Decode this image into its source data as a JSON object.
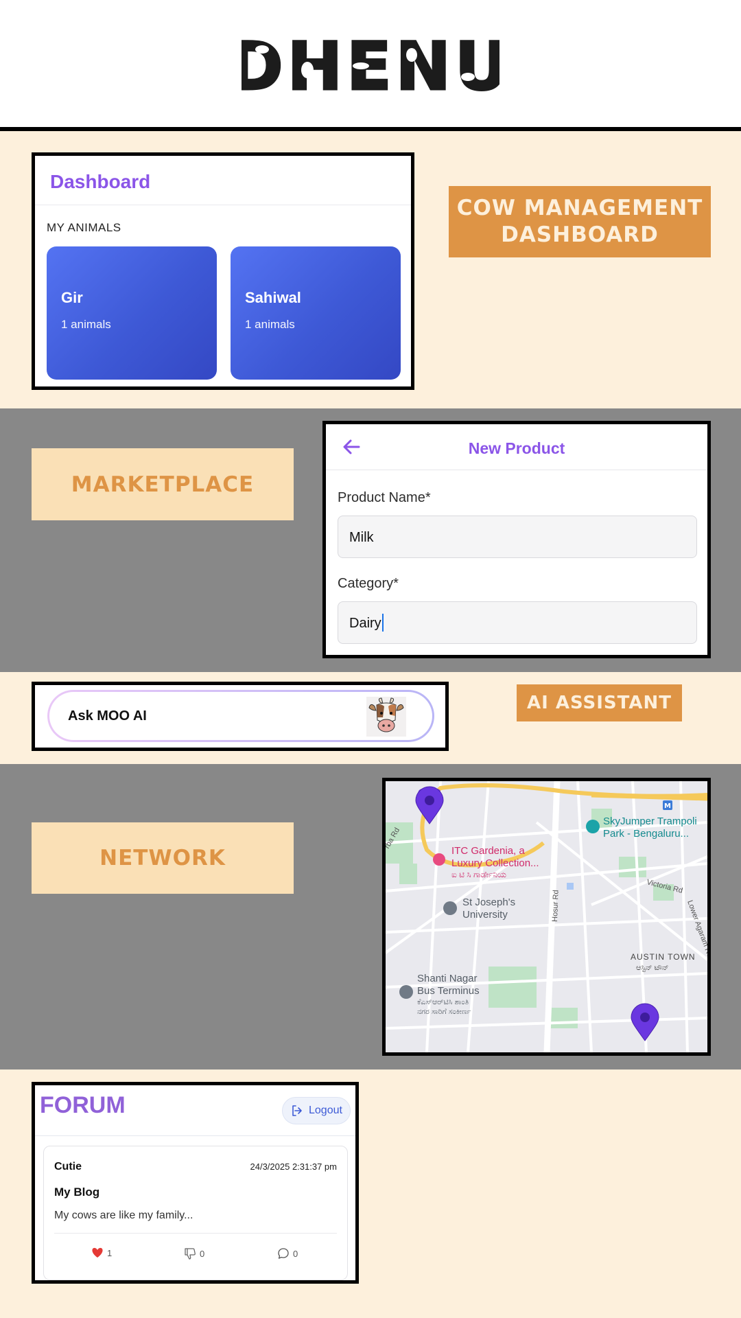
{
  "header": {
    "logo_text": "DHENU"
  },
  "labels": {
    "cow_management": "COW MANAGEMENT DASHBOARD",
    "marketplace": "MARKETPLACE",
    "ai_assistant": "AI ASSISTANT",
    "network": "NETWORK"
  },
  "dashboard": {
    "title": "Dashboard",
    "section": "MY ANIMALS",
    "animals": [
      {
        "name": "Gir",
        "count": "1 animals"
      },
      {
        "name": "Sahiwal",
        "count": "1 animals"
      }
    ]
  },
  "product": {
    "title": "New Product",
    "fields": [
      {
        "label": "Product Name*",
        "value": "Milk"
      },
      {
        "label": "Category*",
        "value": "Dairy"
      }
    ]
  },
  "ai": {
    "prompt": "Ask MOO AI"
  },
  "map": {
    "places": [
      {
        "name": "ITC Gardenia, a",
        "name2": "Luxury Collection...",
        "local": "ಐ ಟಿ ಸಿ ಗಾರ್ಡೇನಿಯ"
      },
      {
        "name": "St Joseph's",
        "name2": "University"
      },
      {
        "name": "SkyJumper Trampoli",
        "name2": "Park - Bengaluru..."
      },
      {
        "name": "Shanti Nagar",
        "name2": "Bus Terminus",
        "local": "ಕೆಎಸ್‌ಆರ್‌ಟಿಸಿ ಶಾಂತಿ",
        "local2": "ನಗರ ಸಾರಿಗೆ ಸಂಕೀರ್ಣ"
      },
      {
        "name": "AUSTIN TOWN",
        "local": "ಆಸ್ಟಿನ್ ಟೌನ್"
      }
    ],
    "roads": [
      "Hosur Rd",
      "Victoria Rd",
      "Lower Agaram Ro",
      "rba Rd"
    ]
  },
  "forum": {
    "title": "FORUM",
    "logout": "Logout",
    "post": {
      "author": "Cutie",
      "date": "24/3/2025 2:31:37 pm",
      "title": "My Blog",
      "body": "My cows are like my family...",
      "likes": "1",
      "dislikes": "0",
      "comments": "0"
    }
  },
  "colors": {
    "cream": "#fdf0dc",
    "gray": "#888888",
    "orange": "#de9445",
    "peach": "#fae0b6",
    "purple": "#8b55e8",
    "tile_blue": "#4a66e6"
  }
}
